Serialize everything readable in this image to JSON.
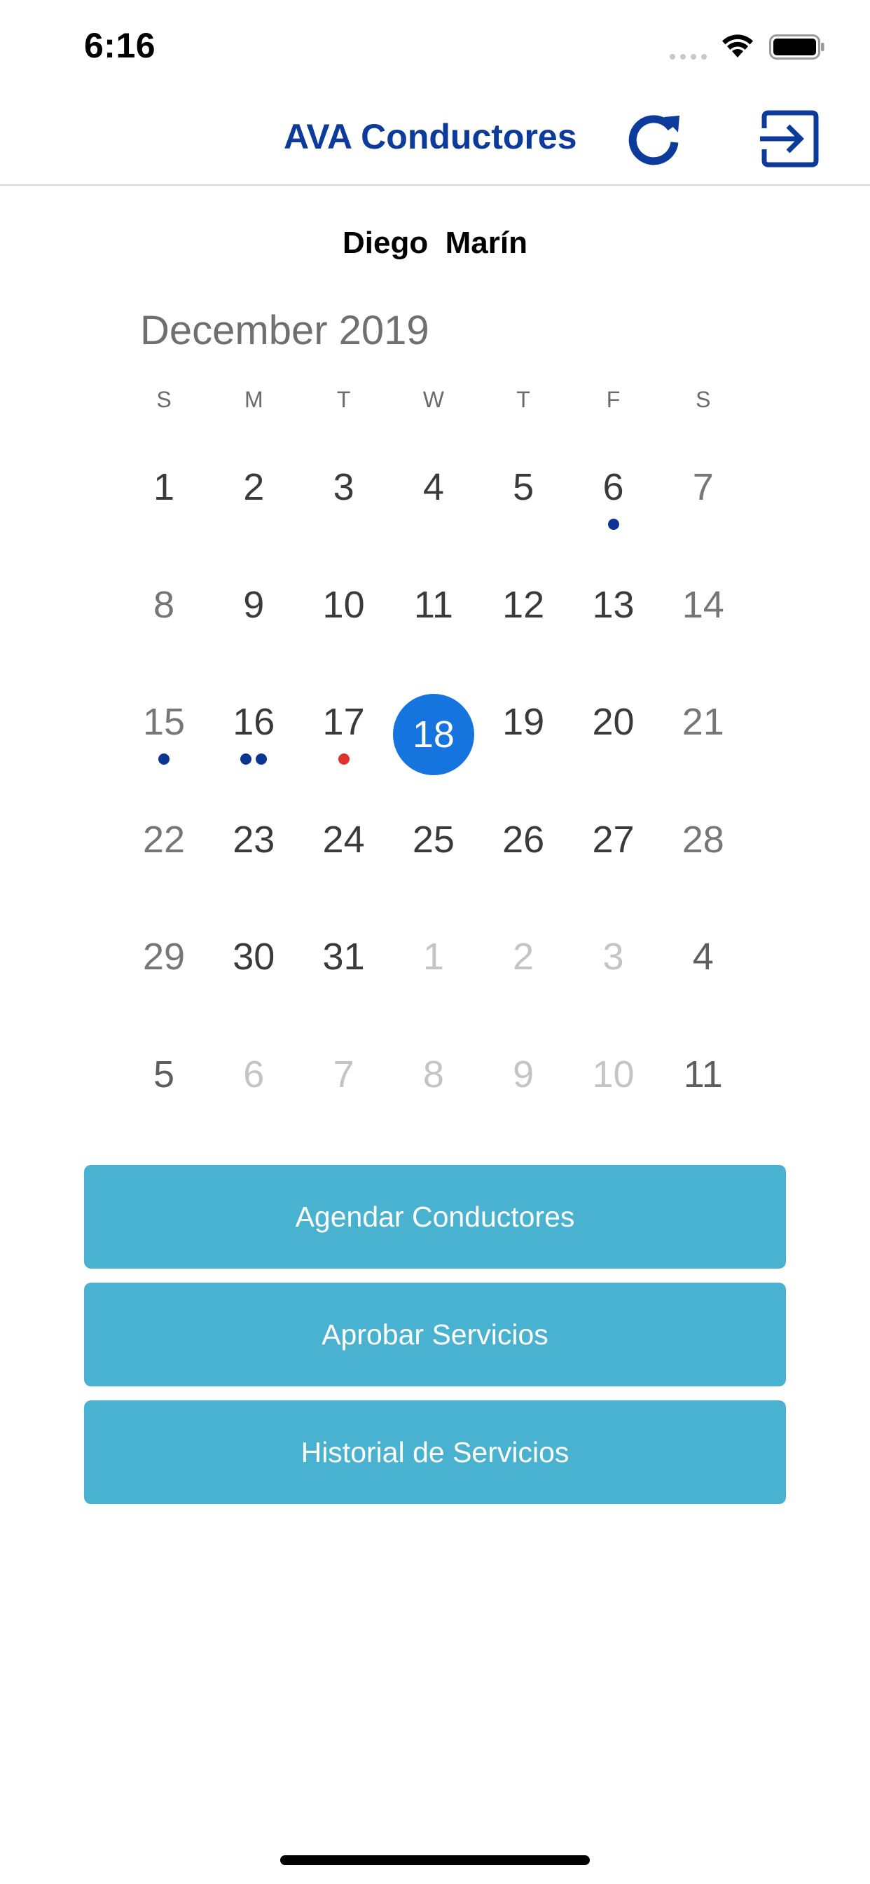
{
  "status_bar": {
    "time": "6:16"
  },
  "nav": {
    "title": "AVA Conductores",
    "refresh_icon": "refresh-icon",
    "logout_icon": "exit-icon",
    "accent_color": "#0c3b9b"
  },
  "user": {
    "name": "Diego  Marín"
  },
  "calendar": {
    "month_label": "December 2019",
    "weekdays": [
      "S",
      "M",
      "T",
      "W",
      "T",
      "F",
      "S"
    ],
    "selected_color": "#1674de",
    "weeks": [
      [
        {
          "day": "1",
          "tone": "current"
        },
        {
          "day": "2",
          "tone": "current"
        },
        {
          "day": "3",
          "tone": "current"
        },
        {
          "day": "4",
          "tone": "current"
        },
        {
          "day": "5",
          "tone": "current"
        },
        {
          "day": "6",
          "tone": "current",
          "dots": [
            "#0d3593"
          ]
        },
        {
          "day": "7",
          "tone": "weekend"
        }
      ],
      [
        {
          "day": "8",
          "tone": "weekend"
        },
        {
          "day": "9",
          "tone": "current"
        },
        {
          "day": "10",
          "tone": "current"
        },
        {
          "day": "11",
          "tone": "current"
        },
        {
          "day": "12",
          "tone": "current"
        },
        {
          "day": "13",
          "tone": "current"
        },
        {
          "day": "14",
          "tone": "weekend"
        }
      ],
      [
        {
          "day": "15",
          "tone": "weekend",
          "dots": [
            "#0d3593"
          ]
        },
        {
          "day": "16",
          "tone": "current",
          "dots": [
            "#0d3593",
            "#0d3593"
          ]
        },
        {
          "day": "17",
          "tone": "current",
          "dots": [
            "#e0312e"
          ]
        },
        {
          "day": "18",
          "tone": "selected"
        },
        {
          "day": "19",
          "tone": "current"
        },
        {
          "day": "20",
          "tone": "current"
        },
        {
          "day": "21",
          "tone": "weekend"
        }
      ],
      [
        {
          "day": "22",
          "tone": "weekend"
        },
        {
          "day": "23",
          "tone": "current"
        },
        {
          "day": "24",
          "tone": "current"
        },
        {
          "day": "25",
          "tone": "current"
        },
        {
          "day": "26",
          "tone": "current"
        },
        {
          "day": "27",
          "tone": "current"
        },
        {
          "day": "28",
          "tone": "weekend"
        }
      ],
      [
        {
          "day": "29",
          "tone": "weekend"
        },
        {
          "day": "30",
          "tone": "current"
        },
        {
          "day": "31",
          "tone": "current"
        },
        {
          "day": "1",
          "tone": "other"
        },
        {
          "day": "2",
          "tone": "other"
        },
        {
          "day": "3",
          "tone": "other"
        },
        {
          "day": "4",
          "tone": "other-weekend"
        }
      ],
      [
        {
          "day": "5",
          "tone": "other-weekend"
        },
        {
          "day": "6",
          "tone": "other"
        },
        {
          "day": "7",
          "tone": "other"
        },
        {
          "day": "8",
          "tone": "other"
        },
        {
          "day": "9",
          "tone": "other"
        },
        {
          "day": "10",
          "tone": "other"
        },
        {
          "day": "11",
          "tone": "other-weekend"
        }
      ]
    ]
  },
  "actions": {
    "button_color": "#4ab2d1",
    "items": [
      {
        "label": "Agendar Conductores"
      },
      {
        "label": "Aprobar Servicios"
      },
      {
        "label": "Historial de Servicios"
      }
    ]
  }
}
